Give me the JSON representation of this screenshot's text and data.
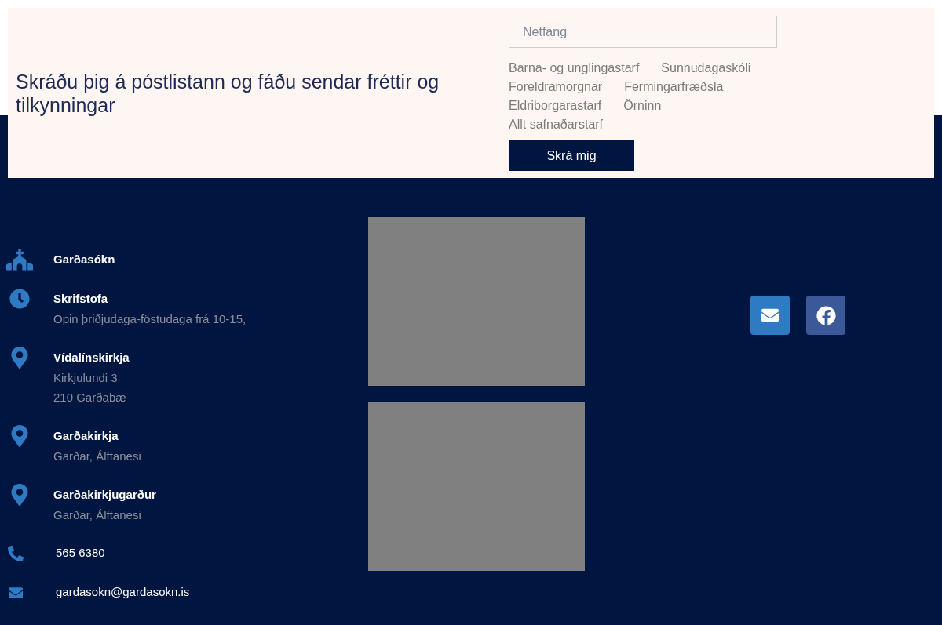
{
  "signup": {
    "heading": "Skráðu þig á póstlistann og fáðu sendar fréttir og tilkynningar",
    "email_field": {
      "placeholder": "Netfang"
    },
    "category_rows": [
      [
        "Barna- og unglingastarf",
        "Sunnudagaskóli"
      ],
      [
        "Foreldramorgnar",
        "Fermingarfræðsla"
      ],
      [
        "Eldriborgarastarf",
        "Örninn"
      ],
      [
        "Allt safnaðarstarf"
      ]
    ],
    "submit": "Skrá mig"
  },
  "contacts": [
    {
      "kind": "church",
      "title": "Garðasókn"
    },
    {
      "kind": "clock",
      "title": "Skrifstofa",
      "lines": [
        "Opin þriðjudaga-föstudaga frá 10-15,"
      ]
    },
    {
      "kind": "pin",
      "title": "Vídalínskirkja",
      "lines": [
        "Kirkjulundi 3",
        "210 Garðabæ"
      ]
    },
    {
      "kind": "pin",
      "title": "Garðakirkja",
      "lines": [
        "Garðar, Álftanesi"
      ]
    },
    {
      "kind": "pin",
      "title": "Garðakirkjugarður",
      "lines": [
        "Garðar, Álftanesi"
      ]
    },
    {
      "kind": "phone",
      "text": "565 6380"
    },
    {
      "kind": "email",
      "text": "gardasokn@gardasokn.is"
    }
  ],
  "social": [
    {
      "kind": "email",
      "color": "#2e7bc4"
    },
    {
      "kind": "facebook",
      "color": "#3b5998"
    }
  ]
}
